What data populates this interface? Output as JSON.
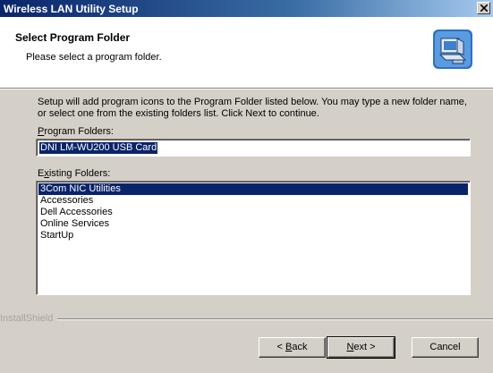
{
  "window": {
    "title": "Wireless LAN Utility Setup"
  },
  "header": {
    "title": "Select Program Folder",
    "subtitle": "Please select a program folder."
  },
  "instructions": "Setup will add program icons to the Program Folder listed below.  You may type a new folder name, or select one from the existing folders list.  Click Next to continue.",
  "program_folders": {
    "label_key": "P",
    "label_rest": "rogram Folders:",
    "value": "DNI LM-WU200 USB Card"
  },
  "existing_folders": {
    "label_key": "x",
    "label_pre": "E",
    "label_rest": "isting Folders:",
    "items": [
      "3Com NIC Utilities",
      "Accessories",
      "Dell Accessories",
      "Online Services",
      "StartUp"
    ],
    "selected_index": 0
  },
  "brand": "InstallShield",
  "buttons": {
    "back_pre": "< ",
    "back_key": "B",
    "back_rest": "ack",
    "next_key": "N",
    "next_rest": "ext >",
    "cancel": "Cancel"
  },
  "icons": {
    "close": "close-icon",
    "header": "computer-setup-icon"
  }
}
